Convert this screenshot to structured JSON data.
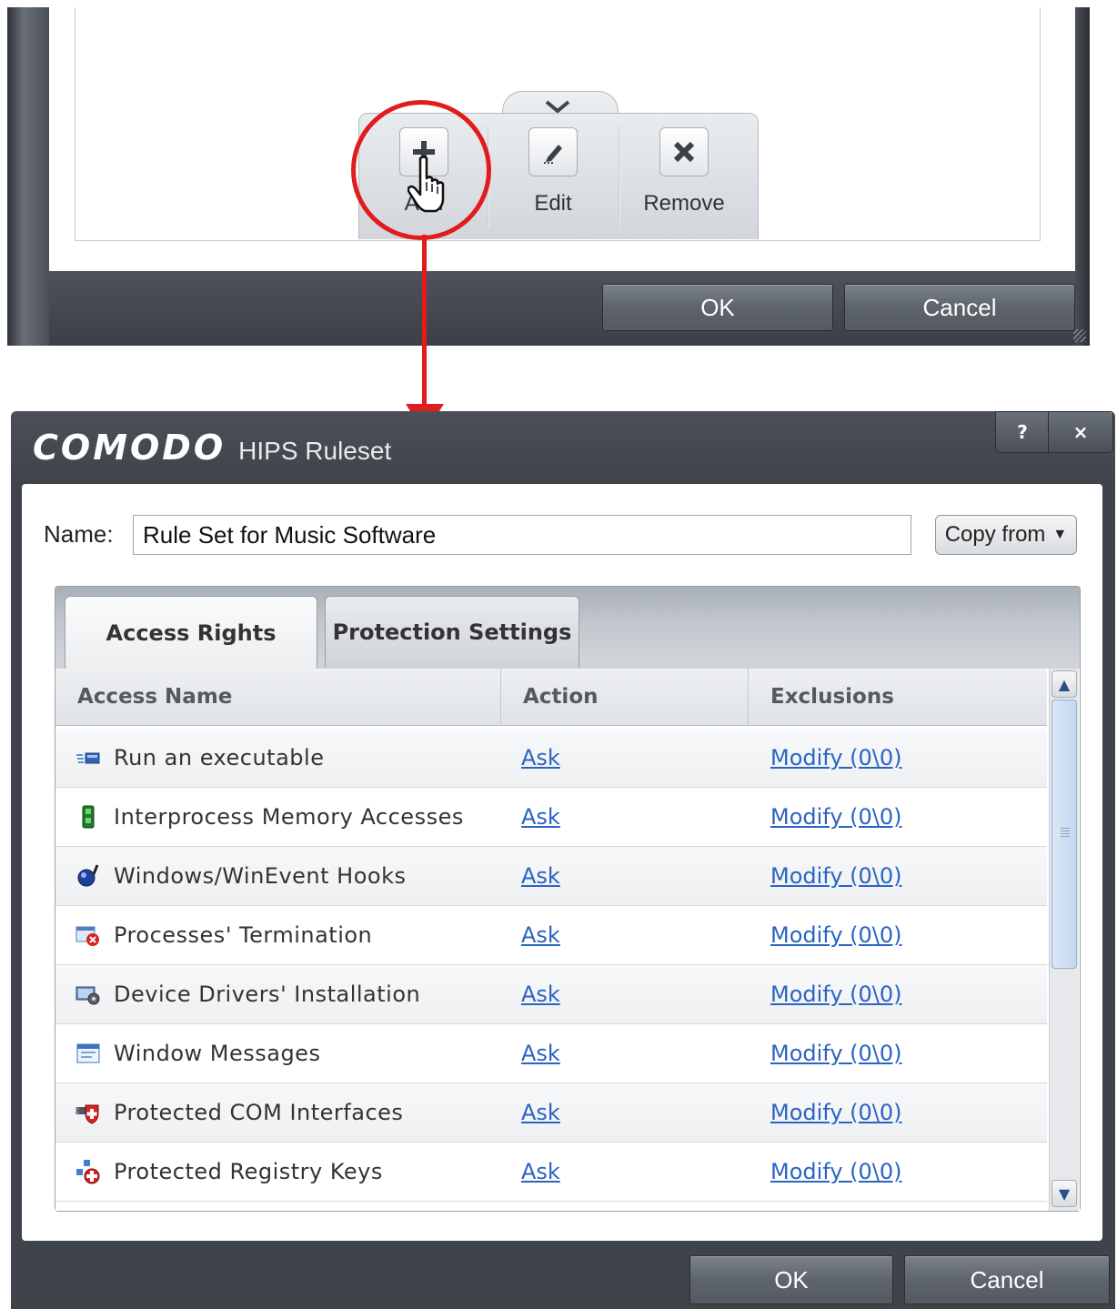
{
  "top_window": {
    "toolbar": {
      "add_label": "Add",
      "edit_label": "Edit",
      "remove_label": "Remove"
    },
    "ok_label": "OK",
    "cancel_label": "Cancel"
  },
  "dialog": {
    "brand": "COMODO",
    "title": "HIPS Ruleset",
    "help_label": "?",
    "close_label": "×",
    "name_label": "Name:",
    "name_value": "Rule Set for Music Software",
    "copy_from_label": "Copy from",
    "tabs": [
      {
        "label": "Access Rights",
        "active": true
      },
      {
        "label": "Protection Settings",
        "active": false
      }
    ],
    "table": {
      "headers": [
        "Access Name",
        "Action",
        "Exclusions"
      ],
      "rows": [
        {
          "icon": "run-executable-icon",
          "name": "Run an executable",
          "action": "Ask",
          "exclusions": "Modify (0\\0)"
        },
        {
          "icon": "interprocess-memory-icon",
          "name": "Interprocess Memory Accesses",
          "action": "Ask",
          "exclusions": "Modify (0\\0)"
        },
        {
          "icon": "hooks-icon",
          "name": "Windows/WinEvent Hooks",
          "action": "Ask",
          "exclusions": "Modify (0\\0)"
        },
        {
          "icon": "process-termination-icon",
          "name": "Processes' Termination",
          "action": "Ask",
          "exclusions": "Modify (0\\0)"
        },
        {
          "icon": "device-drivers-icon",
          "name": "Device Drivers' Installation",
          "action": "Ask",
          "exclusions": "Modify (0\\0)"
        },
        {
          "icon": "window-messages-icon",
          "name": "Window Messages",
          "action": "Ask",
          "exclusions": "Modify (0\\0)"
        },
        {
          "icon": "com-interfaces-icon",
          "name": "Protected COM Interfaces",
          "action": "Ask",
          "exclusions": "Modify (0\\0)"
        },
        {
          "icon": "registry-keys-icon",
          "name": "Protected Registry Keys",
          "action": "Ask",
          "exclusions": "Modify (0\\0)"
        }
      ]
    },
    "ok_label": "OK",
    "cancel_label": "Cancel"
  },
  "colors": {
    "annotation_red": "#e21c1c",
    "link_blue": "#2b63c4",
    "dark_chrome": "#3f434a"
  }
}
